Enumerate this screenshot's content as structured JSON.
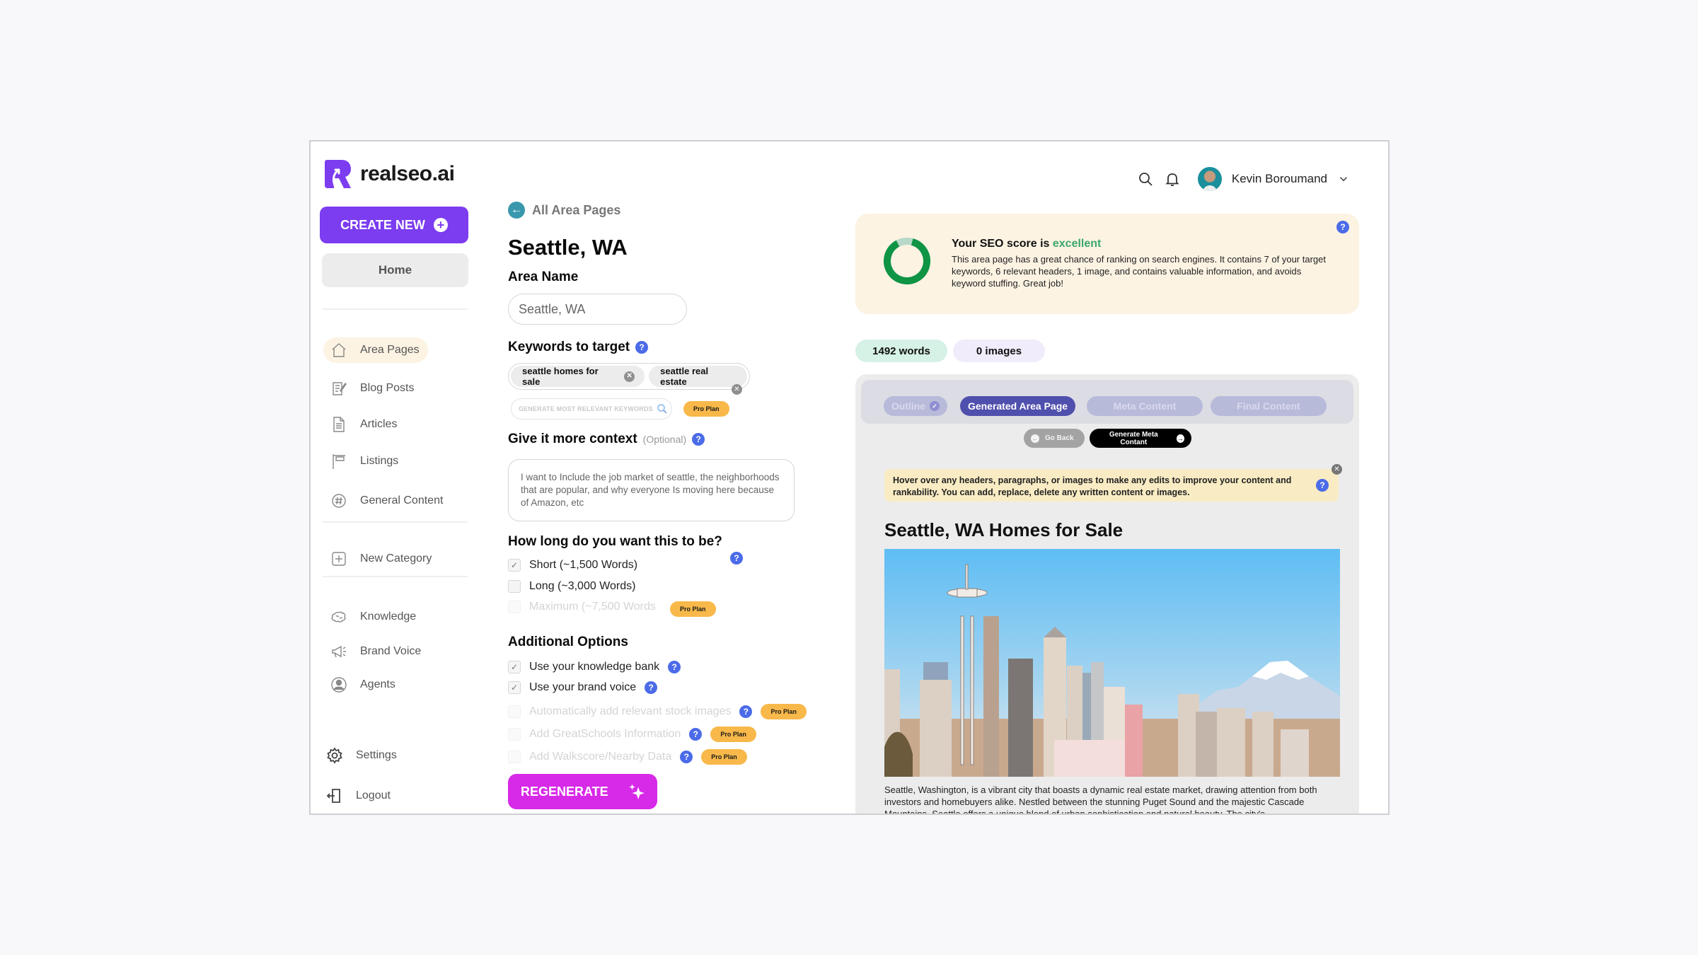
{
  "app": {
    "brand": "realseo.ai",
    "brand_color": "#7c3cf0"
  },
  "sidebar": {
    "create_new_label": "CREATE NEW",
    "home_label": "Home",
    "items": [
      {
        "label": "Area Pages",
        "icon": "house-icon",
        "active": true
      },
      {
        "label": "Blog Posts",
        "icon": "blog-edit-icon",
        "active": false
      },
      {
        "label": "Articles",
        "icon": "document-icon",
        "active": false
      },
      {
        "label": "Listings",
        "icon": "sign-post-icon",
        "active": false
      },
      {
        "label": "General Content",
        "icon": "hashtag-icon",
        "active": false
      }
    ],
    "new_category_label": "New Category",
    "tools": [
      {
        "label": "Knowledge",
        "icon": "brain-icon"
      },
      {
        "label": "Brand Voice",
        "icon": "megaphone-icon"
      },
      {
        "label": "Agents",
        "icon": "user-circle-icon"
      }
    ],
    "settings_label": "Settings",
    "logout_label": "Logout"
  },
  "header": {
    "user_name": "Kevin Boroumand"
  },
  "form": {
    "back_label": "All Area Pages",
    "page_title": "Seattle, WA",
    "area_name_label": "Area Name",
    "area_name_value": "Seattle, WA",
    "keywords_label": "Keywords to target",
    "keywords": [
      "seattle homes for sale",
      "seattle real estate"
    ],
    "generate_keywords_placeholder": "GENERATE MOST RELEVANT KEYWORDS",
    "pro_plan_label": "Pro Plan",
    "context_label": "Give it more context",
    "context_optional": "(Optional)",
    "context_value": "I want to Include the job market of seattle, the neighborhoods that are popular, and why everyone Is moving here because of Amazon, etc",
    "length_label": "How long do you want this to be?",
    "length_options": [
      {
        "label": "Short (~1,500 Words)",
        "checked": true,
        "disabled": false
      },
      {
        "label": "Long (~3,000 Words)",
        "checked": false,
        "disabled": false
      },
      {
        "label": "Maximum (~7,500 Words",
        "checked": false,
        "disabled": true,
        "pro": true
      }
    ],
    "additional_label": "Additional Options",
    "additional_options": [
      {
        "label": "Use your knowledge bank",
        "checked": true,
        "disabled": false
      },
      {
        "label": "Use your brand voice",
        "checked": true,
        "disabled": false
      },
      {
        "label": "Automatically add relevant stock images",
        "checked": false,
        "disabled": true,
        "pro": true
      },
      {
        "label": "Add GreatSchools Information",
        "checked": false,
        "disabled": true,
        "pro": true
      },
      {
        "label": "Add Walkscore/Nearby Data",
        "checked": false,
        "disabled": true,
        "pro": true
      }
    ],
    "regenerate_label": "REGENERATE"
  },
  "seo": {
    "title_prefix": "Your SEO score is",
    "rating": "excellent",
    "score_fraction": 0.88,
    "description": "This area page has a great chance of ranking on search engines. It contains 7 of your target keywords, 6 relevant headers, 1 image, and contains valuable information, and avoids keyword stuffing. Great job!",
    "ring_color": "#0e9444",
    "ring_track_color": "#b7d8c8"
  },
  "stats": {
    "words": "1492 words",
    "images": "0 images"
  },
  "preview": {
    "steps": [
      {
        "label": "Outline",
        "state": "done"
      },
      {
        "label": "Generated Area Page",
        "state": "active"
      },
      {
        "label": "Meta Content",
        "state": "pending"
      },
      {
        "label": "Final Content",
        "state": "pending"
      }
    ],
    "go_back_label": "Go Back",
    "next_label": "Generate Meta Contant",
    "tip": "Hover over any headers, paragraphs, or images to make any edits to improve your content and rankability. You can add, replace, delete any written content or images.",
    "article_title": "Seattle, WA Homes for Sale",
    "hero_image": "seattle-skyline-space-needle-mount-rainier",
    "article_body": "Seattle, Washington, is a vibrant city that boasts a dynamic real estate market, drawing attention from both investors and homebuyers alike. Nestled between the stunning Puget Sound and the majestic Cascade Mountains, Seattle offers a unique blend of urban sophistication and natural beauty. The city's"
  }
}
